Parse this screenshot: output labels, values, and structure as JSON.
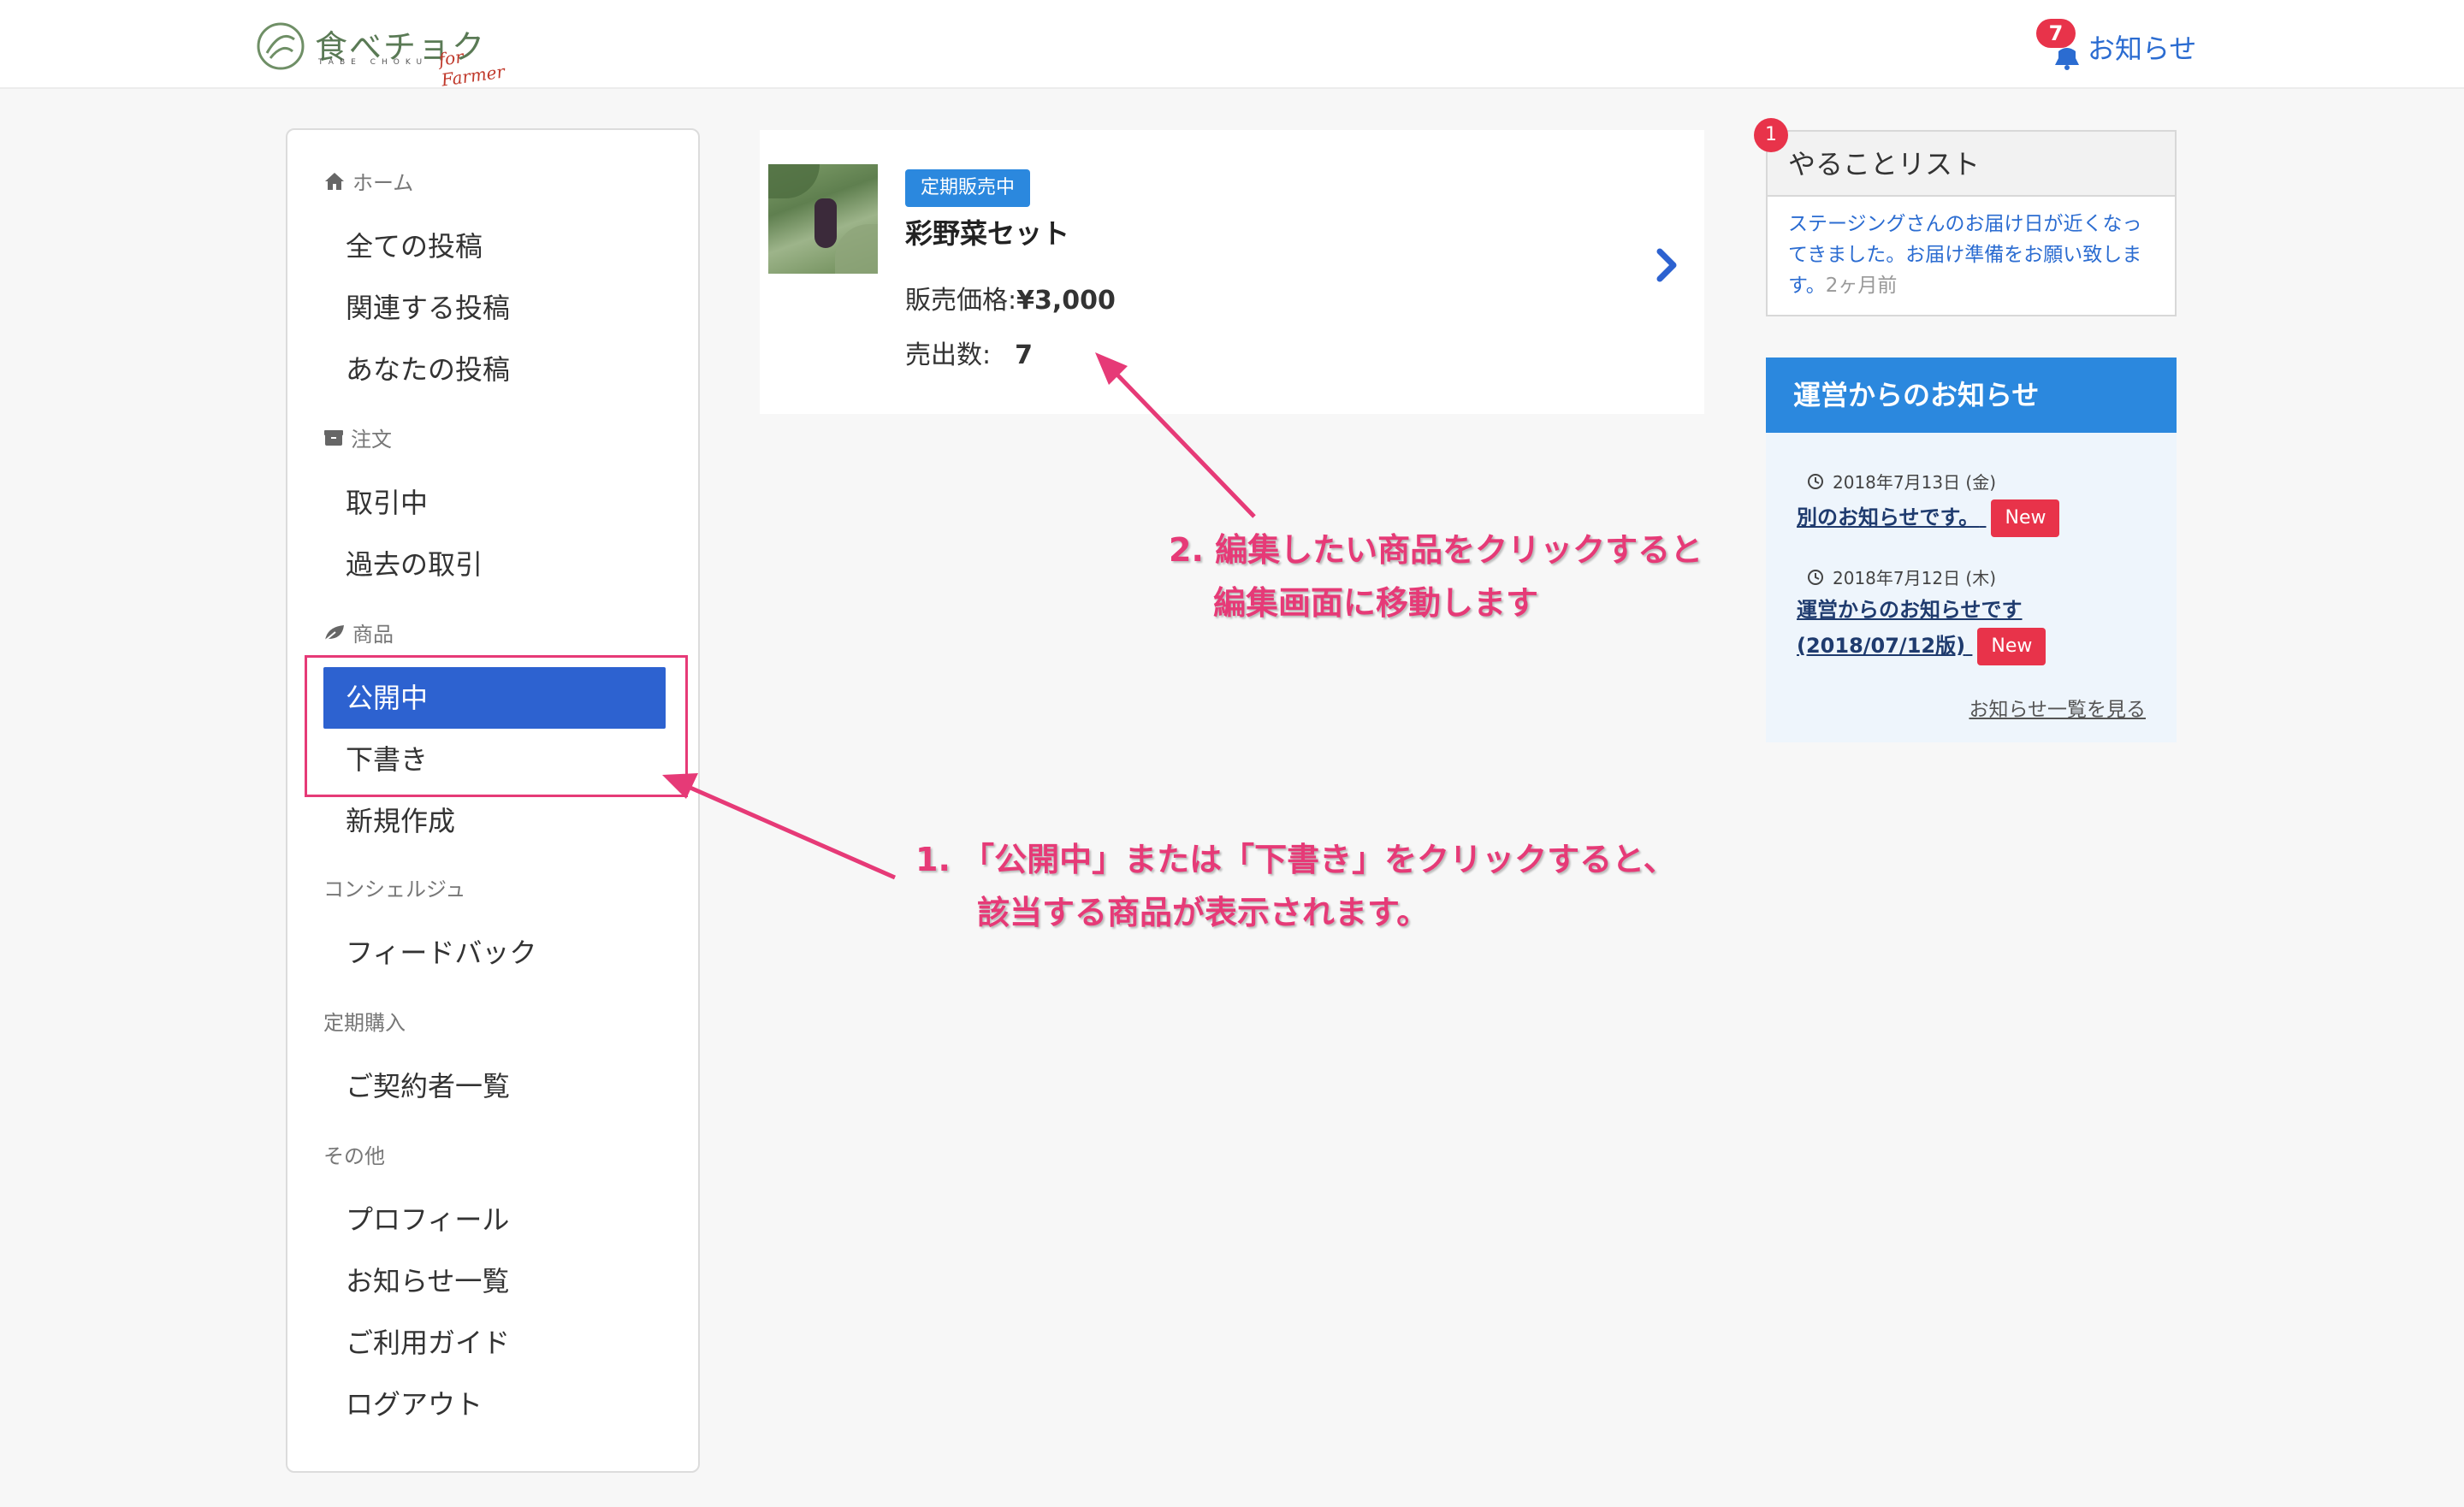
{
  "header": {
    "logo_main": "食べチョク",
    "logo_sub": "TABE CHOKU",
    "logo_for": "for Farmer",
    "notice_count": "7",
    "notice_label": "お知らせ"
  },
  "sidebar": {
    "sections": [
      {
        "label": "ホーム",
        "icon": "home-icon",
        "items": [
          "全ての投稿",
          "関連する投稿",
          "あなたの投稿"
        ]
      },
      {
        "label": "注文",
        "icon": "box-icon",
        "items": [
          "取引中",
          "過去の取引"
        ]
      },
      {
        "label": "商品",
        "icon": "leaf-icon",
        "items": [
          "公開中",
          "下書き",
          "新規作成"
        ]
      },
      {
        "label": "コンシェルジュ",
        "items": [
          "フィードバック"
        ]
      },
      {
        "label": "定期購入",
        "items": [
          "ご契約者一覧"
        ]
      },
      {
        "label": "その他",
        "items": [
          "プロフィール",
          "お知らせ一覧",
          "ご利用ガイド",
          "ログアウト"
        ]
      }
    ],
    "active_item": "公開中",
    "active_color": "#2d62d0"
  },
  "product": {
    "status": "定期販売中",
    "name": "彩野菜セット",
    "price_label": "販売価格:",
    "price_value": "¥3,000",
    "sales_label": "売出数:",
    "sales_value": "7"
  },
  "annotations": {
    "note2_line1": "2. 編集したい商品をクリックすると",
    "note2_line2": "編集画面に移動します",
    "note1_line1": "1. 「公開中」または「下書き」をクリックすると、",
    "note1_line2": "該当する商品が表示されます。",
    "color": "#e63a77"
  },
  "todo": {
    "badge": "1",
    "title": "やることリスト",
    "message": "ステージングさんのお届け日が近くなってきました。お届け準備をお願い致します。",
    "ago": "2ヶ月前"
  },
  "news": {
    "title": "運営からのお知らせ",
    "items": [
      {
        "date": "2018年7月13日 (金)",
        "title": "別のお知らせです。",
        "badge": "New"
      },
      {
        "date": "2018年7月12日 (木)",
        "title_line1": "運営からのお知らせです",
        "title_line2": "(2018/07/12版)",
        "badge": "New"
      }
    ],
    "more": "お知らせ一覧を見る",
    "header_color": "#2b88de"
  }
}
